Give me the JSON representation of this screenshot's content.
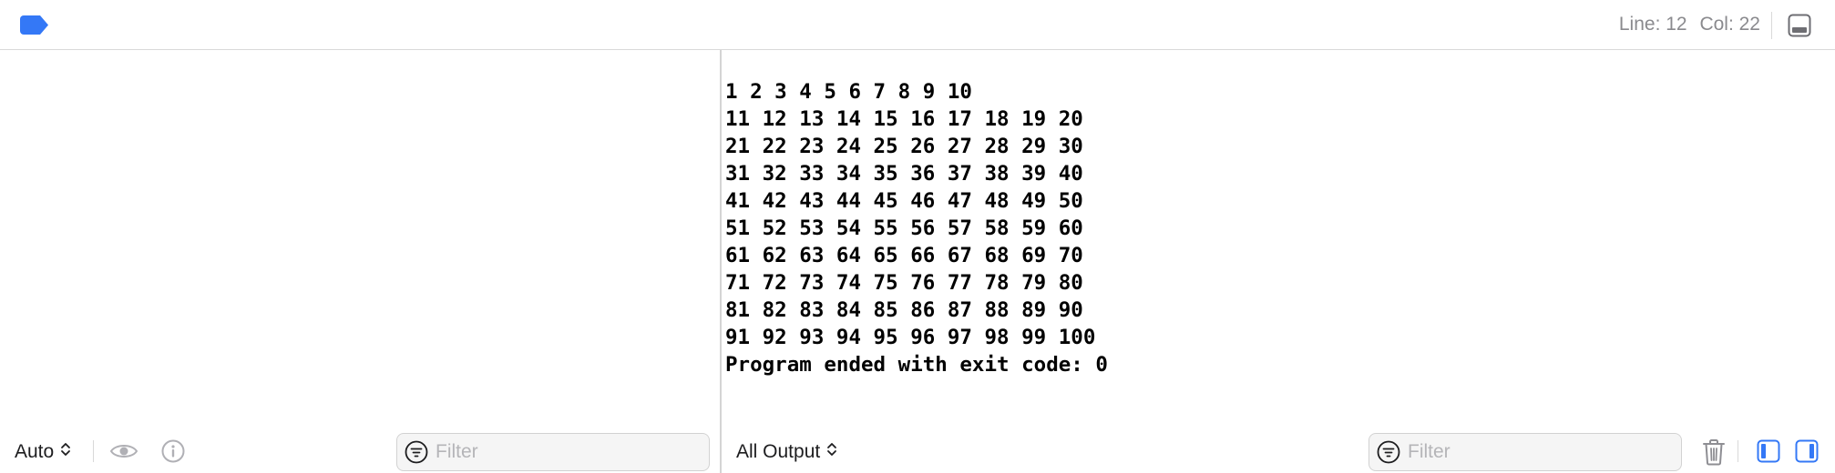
{
  "topbar": {
    "line_label": "Line: 12",
    "col_label": "Col: 22",
    "breakpoint_icon": "breakpoint-icon",
    "toggle_icon": "toggle-console-icon",
    "accent_color": "#3478f6"
  },
  "variables": {
    "scope_popup": "Auto",
    "eye_icon": "eye-icon",
    "info_icon": "info-icon",
    "filter": {
      "placeholder": "Filter",
      "value": ""
    }
  },
  "console": {
    "output_popup": "All Output",
    "lines": [
      "1 2 3 4 5 6 7 8 9 10",
      "11 12 13 14 15 16 17 18 19 20",
      "21 22 23 24 25 26 27 28 29 30",
      "31 32 33 34 35 36 37 38 39 40",
      "41 42 43 44 45 46 47 48 49 50",
      "51 52 53 54 55 56 57 58 59 60",
      "61 62 63 64 65 66 67 68 69 70",
      "71 72 73 74 75 76 77 78 79 80",
      "81 82 83 84 85 86 87 88 89 90",
      "91 92 93 94 95 96 97 98 99 100",
      "Program ended with exit code: 0"
    ],
    "filter": {
      "placeholder": "Filter",
      "value": ""
    },
    "trash_icon": "trash-icon",
    "left_panel_icon": "show-variables-icon",
    "right_panel_icon": "show-console-icon"
  }
}
